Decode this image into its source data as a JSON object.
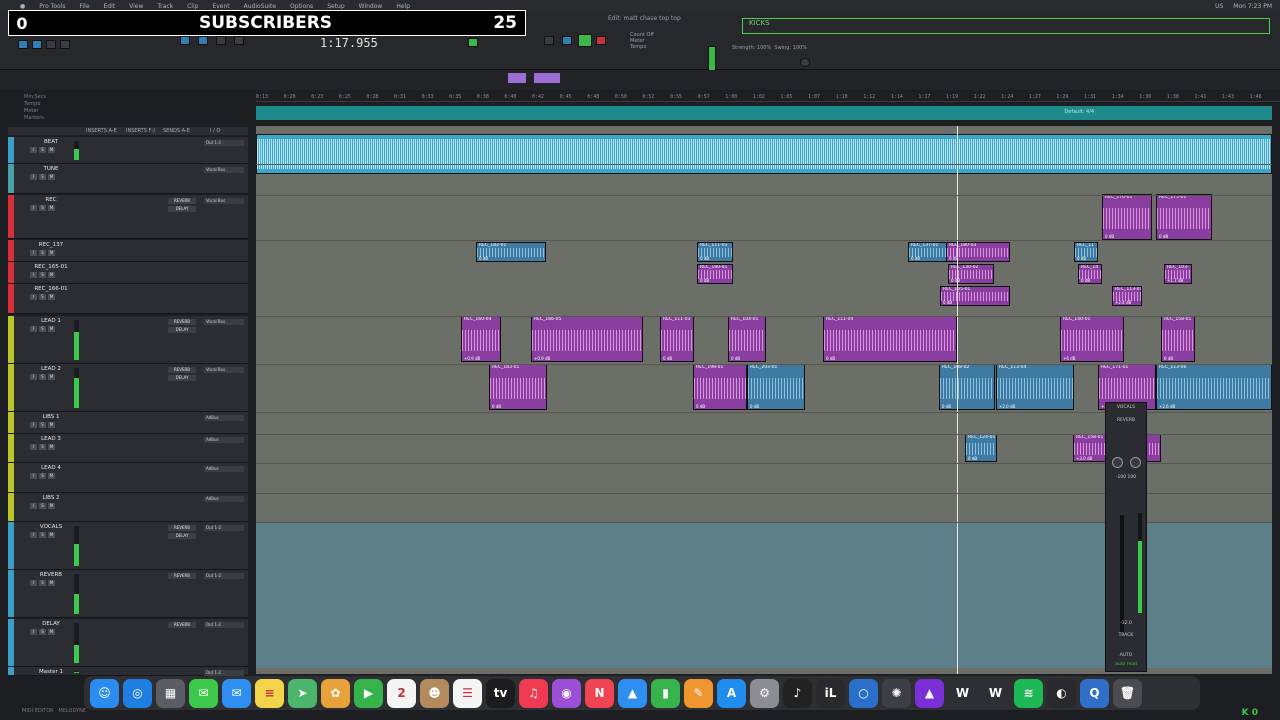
{
  "overlay": {
    "left_count": "0",
    "label": "SUBSCRIBERS",
    "right_count": "25"
  },
  "menubar": {
    "app": "Pro Tools",
    "items": [
      "File",
      "Edit",
      "View",
      "Track",
      "Clip",
      "Event",
      "AudioSuite",
      "Options",
      "Setup",
      "Window",
      "Help"
    ],
    "right": [
      "US",
      "Mon 7:23 PM"
    ]
  },
  "transport": {
    "counter": "1:17.955",
    "window_title": "Edit: matt chase top top",
    "kicks_label": "KICKS",
    "strength_label": "Strength:",
    "strength_value": "100%",
    "swing_label": "Swing:",
    "swing_value": "100%",
    "count_off": "Count Off",
    "meter": "Meter",
    "tempo": "Tempo"
  },
  "ruler": {
    "ticks": [
      "0:13",
      "0:20",
      "0:23",
      "0:25",
      "0:28",
      "0:31",
      "0:33",
      "0:35",
      "0:38",
      "0:40",
      "0:42",
      "0:45",
      "0:48",
      "0:50",
      "0:52",
      "0:55",
      "0:57",
      "1:00",
      "1:02",
      "1:05",
      "1:07",
      "1:10",
      "1:12",
      "1:14",
      "1:17",
      "1:19",
      "1:22",
      "1:24",
      "1:27",
      "1:29",
      "1:31",
      "1:34",
      "1:36",
      "1:38",
      "1:41",
      "1:43",
      "1:46"
    ],
    "left_rows": [
      "Min:Secs",
      "Tempo",
      "Meter",
      "Markers"
    ],
    "default_marker": "Default: 4/4"
  },
  "column_headers": {
    "inserts_ae": "INSERTS A-E",
    "inserts_fj": "INSERTS F-J",
    "sends_ae": "SENDS A-E",
    "io": "I / O"
  },
  "tracks": [
    {
      "name": "BEAT",
      "color": "#3aa0c8",
      "meter": 0.6,
      "plugs": [],
      "io": "Out 1-2"
    },
    {
      "name": "TUNE",
      "color": "#4aa0a8",
      "meter": 0.0,
      "plugs": [],
      "io": "Vocal Bus"
    },
    {
      "name": "REC",
      "color": "#d8303a",
      "meter": 0.0,
      "plugs": [
        "REVERB",
        "DELAY"
      ],
      "io": "Vocal Bus"
    },
    {
      "name": "REC_137",
      "color": "#d8303a",
      "meter": 0.0,
      "plugs": [],
      "io": ""
    },
    {
      "name": "REC_165-01",
      "color": "#d8303a",
      "meter": 0.0,
      "plugs": [],
      "io": ""
    },
    {
      "name": "REC_166-01",
      "color": "#d8303a",
      "meter": 0.0,
      "plugs": [],
      "io": ""
    },
    {
      "name": "LEAD 1",
      "color": "#b8c428",
      "meter": 0.7,
      "plugs": [
        "REVERB",
        "DELAY"
      ],
      "io": "Vocal Bus"
    },
    {
      "name": "LEAD 2",
      "color": "#b8c428",
      "meter": 0.75,
      "plugs": [
        "REVERB",
        "DELAY"
      ],
      "io": "Vocal Bus"
    },
    {
      "name": "LIBS 1",
      "color": "#b8c428",
      "meter": 0.0,
      "plugs": [],
      "io": "AdBus"
    },
    {
      "name": "LEAD 3",
      "color": "#b8c428",
      "meter": 0.0,
      "plugs": [],
      "io": "AdBus"
    },
    {
      "name": "LEAD 4",
      "color": "#b8c428",
      "meter": 0.0,
      "plugs": [],
      "io": "AdBus"
    },
    {
      "name": "LIBS 2",
      "color": "#b8c428",
      "meter": 0.0,
      "plugs": [],
      "io": "AdBus"
    },
    {
      "name": "VOCALS",
      "color": "#3aa0c8",
      "meter": 0.55,
      "plugs": [
        "REVERB",
        "DELAY"
      ],
      "io": "Out 1-2"
    },
    {
      "name": "REVERB",
      "color": "#3aa0c8",
      "meter": 0.5,
      "plugs": [
        "REVERB"
      ],
      "io": "Out 1-2"
    },
    {
      "name": "DELAY",
      "color": "#3aa0c8",
      "meter": 0.45,
      "plugs": [
        "REVERB"
      ],
      "io": "Out 1-2"
    },
    {
      "name": "Master 1",
      "color": "#3aa0c8",
      "meter": 0.5,
      "plugs": [],
      "io": "Out 1-2"
    }
  ],
  "clips": {
    "rec_lane": [
      {
        "label": "REC_182-01",
        "gain": "0 dB"
      },
      {
        "label": "REC_111-03",
        "gain": "0 dB"
      },
      {
        "label": "REC_180-01",
        "gain": "0 dB"
      },
      {
        "label": "REC_137-01",
        "gain": "0 dB"
      },
      {
        "label": "REC_180-03",
        "gain": "0 dB"
      },
      {
        "label": "REC_130-02",
        "gain": "0 dB"
      },
      {
        "label": "REC_165-01",
        "gain": "0 dB"
      },
      {
        "label": "REC_11",
        "gain": "0 dB"
      },
      {
        "label": "REC_14",
        "gain": "0 dB"
      },
      {
        "label": "REC_113-01",
        "gain": "+2.4 dB"
      },
      {
        "label": "REC_170-01",
        "gain": "0 dB"
      },
      {
        "label": "REC_175-01",
        "gain": "0 dB"
      },
      {
        "label": "REC_103-",
        "gain": "+1.7 dB"
      }
    ],
    "lead1": [
      {
        "label": "REC_160-04",
        "gain": "+0.9 dB"
      },
      {
        "label": "REC_166-05",
        "gain": "+0.9 dB"
      },
      {
        "label": "REC_111-03",
        "gain": "0 dB"
      },
      {
        "label": "REC_104-01",
        "gain": "0 dB"
      },
      {
        "label": "REC_111-04",
        "gain": "0 dB"
      },
      {
        "label": "REC_140-01",
        "gain": "+6 dB"
      },
      {
        "label": "REC_158-01",
        "gain": "0 dB"
      }
    ],
    "lead2": [
      {
        "label": "REC_183-01",
        "gain": "0 dB"
      },
      {
        "label": "REC_198-01",
        "gain": "0 dB"
      },
      {
        "label": "REC_203-01",
        "gain": "0 dB"
      },
      {
        "label": "REC_108-02",
        "gain": "0 dB"
      },
      {
        "label": "REC_113-04",
        "gain": "+2.0 dB"
      },
      {
        "label": "REC_171-01",
        "gain": "+3.8 dB"
      },
      {
        "label": "REC_113-06",
        "gain": "+2.6 dB"
      }
    ],
    "lead3": [
      {
        "label": "REC_124-01",
        "gain": "0 dB"
      },
      {
        "label": "REC_158-01",
        "gain": "+3.0 dB"
      }
    ]
  },
  "strip": {
    "name": "VOCALS",
    "send": "REVERB",
    "pan_value": "-100 100",
    "track_label": "TRACK",
    "auto_label": "AUTO",
    "mode": "auto read",
    "volume": "-12.0"
  },
  "dock": [
    {
      "name": "finder-icon",
      "glyph": "☺",
      "color": "#2b8bf0"
    },
    {
      "name": "safari-icon",
      "glyph": "◎",
      "color": "#1f7fe0"
    },
    {
      "name": "launchpad-icon",
      "glyph": "▦",
      "color": "#5a5d64"
    },
    {
      "name": "messages-icon",
      "glyph": "✉",
      "color": "#3cc84a"
    },
    {
      "name": "mail-icon",
      "glyph": "✉",
      "color": "#2e8ff0"
    },
    {
      "name": "notes-icon",
      "glyph": "≡",
      "color": "#f2d34a"
    },
    {
      "name": "maps-icon",
      "glyph": "➤",
      "color": "#4bb56b"
    },
    {
      "name": "photos-icon",
      "glyph": "✿",
      "color": "#e8a23c"
    },
    {
      "name": "facetime-icon",
      "glyph": "▶",
      "color": "#36b34a"
    },
    {
      "name": "calendar-icon",
      "glyph": "2",
      "color": "#f4f4f4"
    },
    {
      "name": "contacts-icon",
      "glyph": "☻",
      "color": "#b38a5c"
    },
    {
      "name": "reminders-icon",
      "glyph": "☰",
      "color": "#f4f4f4"
    },
    {
      "name": "tv-icon",
      "glyph": "tv",
      "color": "#1c1c1e"
    },
    {
      "name": "music-icon",
      "glyph": "♫",
      "color": "#f03a52"
    },
    {
      "name": "podcasts-icon",
      "glyph": "◉",
      "color": "#9b4fd6"
    },
    {
      "name": "news-icon",
      "glyph": "N",
      "color": "#f04452"
    },
    {
      "name": "keynote-icon",
      "glyph": "▲",
      "color": "#2f8ff0"
    },
    {
      "name": "numbers-icon",
      "glyph": "▮",
      "color": "#36b34a"
    },
    {
      "name": "pages-icon",
      "glyph": "✎",
      "color": "#f0962e"
    },
    {
      "name": "appstore-icon",
      "glyph": "A",
      "color": "#1f8cf0"
    },
    {
      "name": "settings-icon",
      "glyph": "⚙",
      "color": "#8a8d93"
    },
    {
      "name": "protools-icon",
      "glyph": "♪",
      "color": "#222"
    },
    {
      "name": "ilok-icon",
      "glyph": "iL",
      "color": "#2a2a2e"
    },
    {
      "name": "circle-app-icon",
      "glyph": "○",
      "color": "#2a6fc9"
    },
    {
      "name": "gear-app-icon",
      "glyph": "✺",
      "color": "#3c3f46"
    },
    {
      "name": "avid-icon",
      "glyph": "▲",
      "color": "#7b2fd6"
    },
    {
      "name": "waves-icon",
      "glyph": "W",
      "color": "#2d2f35"
    },
    {
      "name": "waves-central-icon",
      "glyph": "W",
      "color": "#2d2f35"
    },
    {
      "name": "spotify-icon",
      "glyph": "≋",
      "color": "#1db954"
    },
    {
      "name": "obs-icon",
      "glyph": "◐",
      "color": "#2a2a2e"
    },
    {
      "name": "quicktime-icon",
      "glyph": "Q",
      "color": "#2f6fc9"
    },
    {
      "name": "trash-icon",
      "glyph": "🗑",
      "color": "#4a4c52"
    }
  ],
  "statusbar": {
    "left": "MIDI EDITOR",
    "mid": "MELODYNE",
    "k_label": "K 0"
  }
}
